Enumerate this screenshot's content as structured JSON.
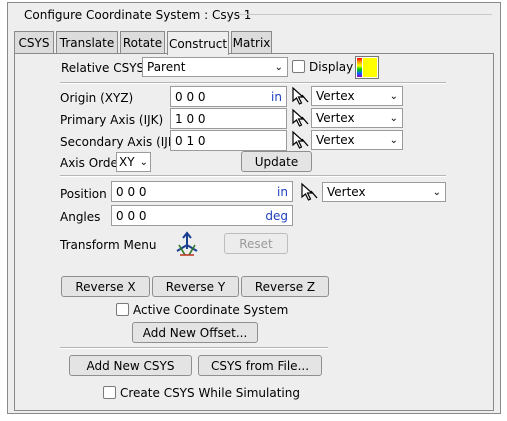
{
  "window": {
    "title": "Configure Coordinate System : Csys 1"
  },
  "tabs": [
    {
      "label": "CSYS",
      "active": false
    },
    {
      "label": "Translate",
      "active": false
    },
    {
      "label": "Rotate",
      "active": false
    },
    {
      "label": "Construct",
      "active": true
    },
    {
      "label": "Matrix",
      "active": false
    }
  ],
  "relative": {
    "label": "Relative CSYS",
    "value": "Parent",
    "display_label": "Display",
    "display_checked": false
  },
  "origin": {
    "label": "Origin (XYZ)",
    "value": "0 0 0",
    "unit": "in",
    "pick": "Vertex"
  },
  "primary": {
    "label": "Primary Axis (IJK)",
    "value": "1 0 0",
    "pick": "Vertex"
  },
  "secondary": {
    "label": "Secondary Axis (IJK)",
    "value": "0 1 0",
    "pick": "Vertex"
  },
  "axis_order": {
    "label": "Axis Order",
    "value": "XY"
  },
  "update_label": "Update",
  "position": {
    "label": "Position",
    "value": "0 0 0",
    "unit": "in",
    "pick": "Vertex"
  },
  "angles": {
    "label": "Angles",
    "value": "0 0 0",
    "unit": "deg"
  },
  "transform": {
    "label": "Transform Menu",
    "reset_label": "Reset"
  },
  "reverse": {
    "x": "Reverse X",
    "y": "Reverse Y",
    "z": "Reverse Z"
  },
  "active_cs": {
    "label": "Active Coordinate System",
    "checked": false
  },
  "add_offset_label": "Add New Offset...",
  "add_csys_label": "Add New CSYS",
  "csys_file_label": "CSYS from File...",
  "create_sim": {
    "label": "Create CSYS While Simulating",
    "checked": false
  },
  "colors": {
    "unit": "#1f3fbf",
    "swatch": "#ffff00"
  }
}
